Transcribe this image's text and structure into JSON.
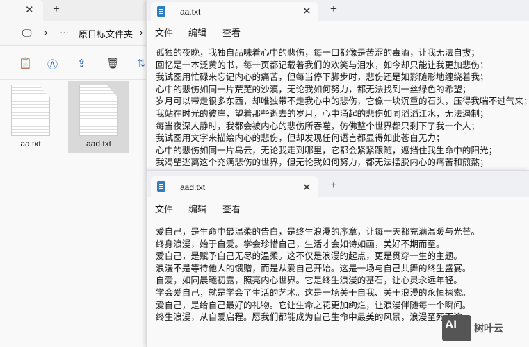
{
  "explorer": {
    "breadcrumb": "原目标文件夹",
    "files": [
      {
        "name": "aa.txt"
      },
      {
        "name": "aad.txt"
      }
    ]
  },
  "notepad1": {
    "tab": "aa.txt",
    "menu": [
      "文件",
      "编辑",
      "查看"
    ],
    "lines": [
      "孤独的夜晚，我独自品味着心中的悲伤，每一口都像是苦涩的毒酒，让我无法自拔；",
      "回忆是一本泛黄的书，每一页都记载着我们的欢笑与泪水，如今却只能让我更加悲伤；",
      "我试图用忙碌来忘记内心的痛苦，但每当停下脚步时，悲伤还是如影随形地缠绕着我；",
      "心中的悲伤如同一片荒芜的沙漠，无论我如何努力，都无法找到一丝绿色的希望；",
      "岁月可以带走很多东西，却唯独带不走我心中的悲伤，它像一块沉重的石头，压得我喘不过气来；",
      "我站在时光的彼岸，望着那些逝去的岁月，心中涌起的悲伤如同滔滔江水，无法遏制；",
      "每当夜深人静时，我都会被内心的悲伤所吞噬，仿佛整个世界都只剩下了我一个人；",
      "我试图用文字来描绘内心的悲伤，但却发现任何语言都显得如此苍白无力；",
      "心中的悲伤如同一片乌云，无论我走到哪里，它都会紧紧跟随，遮挡住我生命中的阳光；",
      "我渴望逃离这个充满悲伤的世界，但无论我如何努力，都无法摆脱内心的痛苦和煎熬；"
    ]
  },
  "notepad2": {
    "tab": "aad.txt",
    "menu": [
      "文件",
      "编辑",
      "查看"
    ],
    "lines": [
      "爱自己，是生命中最温柔的告白，是终生浪漫的序章，让每一天都充满温暖与光芒。",
      "终身浪漫，始于自爱。学会珍惜自己，生活才会如诗如画，美好不期而至。",
      "爱自己，是赋予自己无尽的温柔。这不仅是浪漫的起点，更是贯穿一生的主题。",
      "浪漫不是等待他人的馈赠，而是从爱自己开始。这是一场与自己共舞的终生盛宴。",
      "自爱，如同晨曦初露，照亮内心世界。它是终生浪漫的基石，让心灵永远年轻。",
      "学会爱自己，就是学会了生活的艺术。这是一场关于自我、关于浪漫的永恒探索。",
      "爱自己，是给自己最好的礼物。它让生命之花更加绚烂，让浪漫伴随每一个瞬间。",
      "终生浪漫，从自爱启程。愿我们都能成为自己生命中最美的风景，浪漫至死不渝。"
    ]
  },
  "watermark": {
    "badge": "AI",
    "text": "树叶云"
  }
}
